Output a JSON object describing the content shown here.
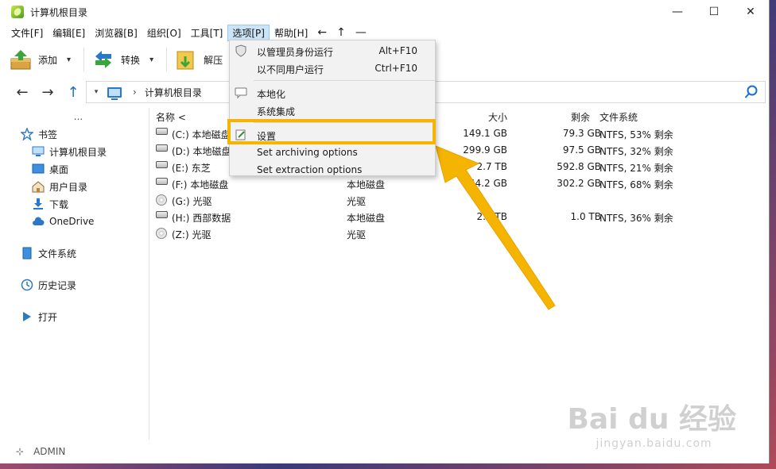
{
  "window": {
    "title": "计算机根目录",
    "controls": [
      "—",
      "☐",
      "✕"
    ]
  },
  "menu": {
    "items": [
      "文件[F]",
      "编辑[E]",
      "浏览器[B]",
      "组织[O]",
      "工具[T]",
      "选项[P]",
      "帮助[H]"
    ],
    "symbols": [
      "←",
      "↑",
      "—"
    ]
  },
  "toolbar": {
    "add_label": "添加",
    "convert_label": "转换",
    "extract_label": "解压"
  },
  "address": {
    "path": "计算机根目录"
  },
  "sidebar": {
    "dots": "...",
    "bookmarks": "书签",
    "items": [
      "计算机根目录",
      "桌面",
      "用户目录",
      "下载",
      "OneDrive"
    ],
    "filesystem": "文件系统",
    "history": "历史记录",
    "open": "打开"
  },
  "list": {
    "headers": {
      "name": "名称",
      "size": "大小",
      "free": "剩余",
      "fs": "文件系统"
    },
    "rows": [
      {
        "name": "(C:) 本地磁盘",
        "type": "",
        "size": "149.1 GB",
        "free": "79.3 GB",
        "fs": "NTFS, 53% 剩余",
        "icon": "drive"
      },
      {
        "name": "(D:) 本地磁盘",
        "type": "",
        "size": "299.9 GB",
        "free": "97.5 GB",
        "fs": "NTFS, 32% 剩余",
        "icon": "drive"
      },
      {
        "name": "(E:) 东芝",
        "type": "",
        "size": "2.7 TB",
        "free": "592.8 GB",
        "fs": "NTFS, 21% 剩余",
        "icon": "drive"
      },
      {
        "name": "(F:) 本地磁盘",
        "type": "本地磁盘",
        "size": "44.2 GB",
        "free": "302.2 GB",
        "fs": "NTFS, 68% 剩余",
        "icon": "drive"
      },
      {
        "name": "(G:) 光驱",
        "type": "光驱",
        "size": "",
        "free": "",
        "fs": "",
        "icon": "disc"
      },
      {
        "name": "(H:) 西部数据",
        "type": "本地磁盘",
        "size": "2.7 TB",
        "free": "1.0 TB",
        "fs": "NTFS, 36% 剩余",
        "icon": "drive"
      },
      {
        "name": "(Z:) 光驱",
        "type": "光驱",
        "size": "",
        "free": "",
        "fs": "",
        "icon": "disc"
      }
    ]
  },
  "dropdown": {
    "items": [
      {
        "label": "以管理员身份运行",
        "shortcut": "Alt+F10"
      },
      {
        "label": "以不同用户运行",
        "shortcut": "Ctrl+F10"
      },
      {
        "label": "本地化",
        "shortcut": ""
      },
      {
        "label": "系统集成",
        "shortcut": ""
      },
      {
        "label": "设置",
        "shortcut": ""
      },
      {
        "label": "Set archiving options",
        "shortcut": ""
      },
      {
        "label": "Set extraction options",
        "shortcut": ""
      }
    ]
  },
  "status": {
    "user": "ADMIN"
  },
  "watermark": {
    "logo": "Bai  du 经验",
    "url": "jingyan.baidu.com"
  },
  "colors": {
    "highlight": "#f5b400",
    "accent": "#1a6fc9"
  }
}
